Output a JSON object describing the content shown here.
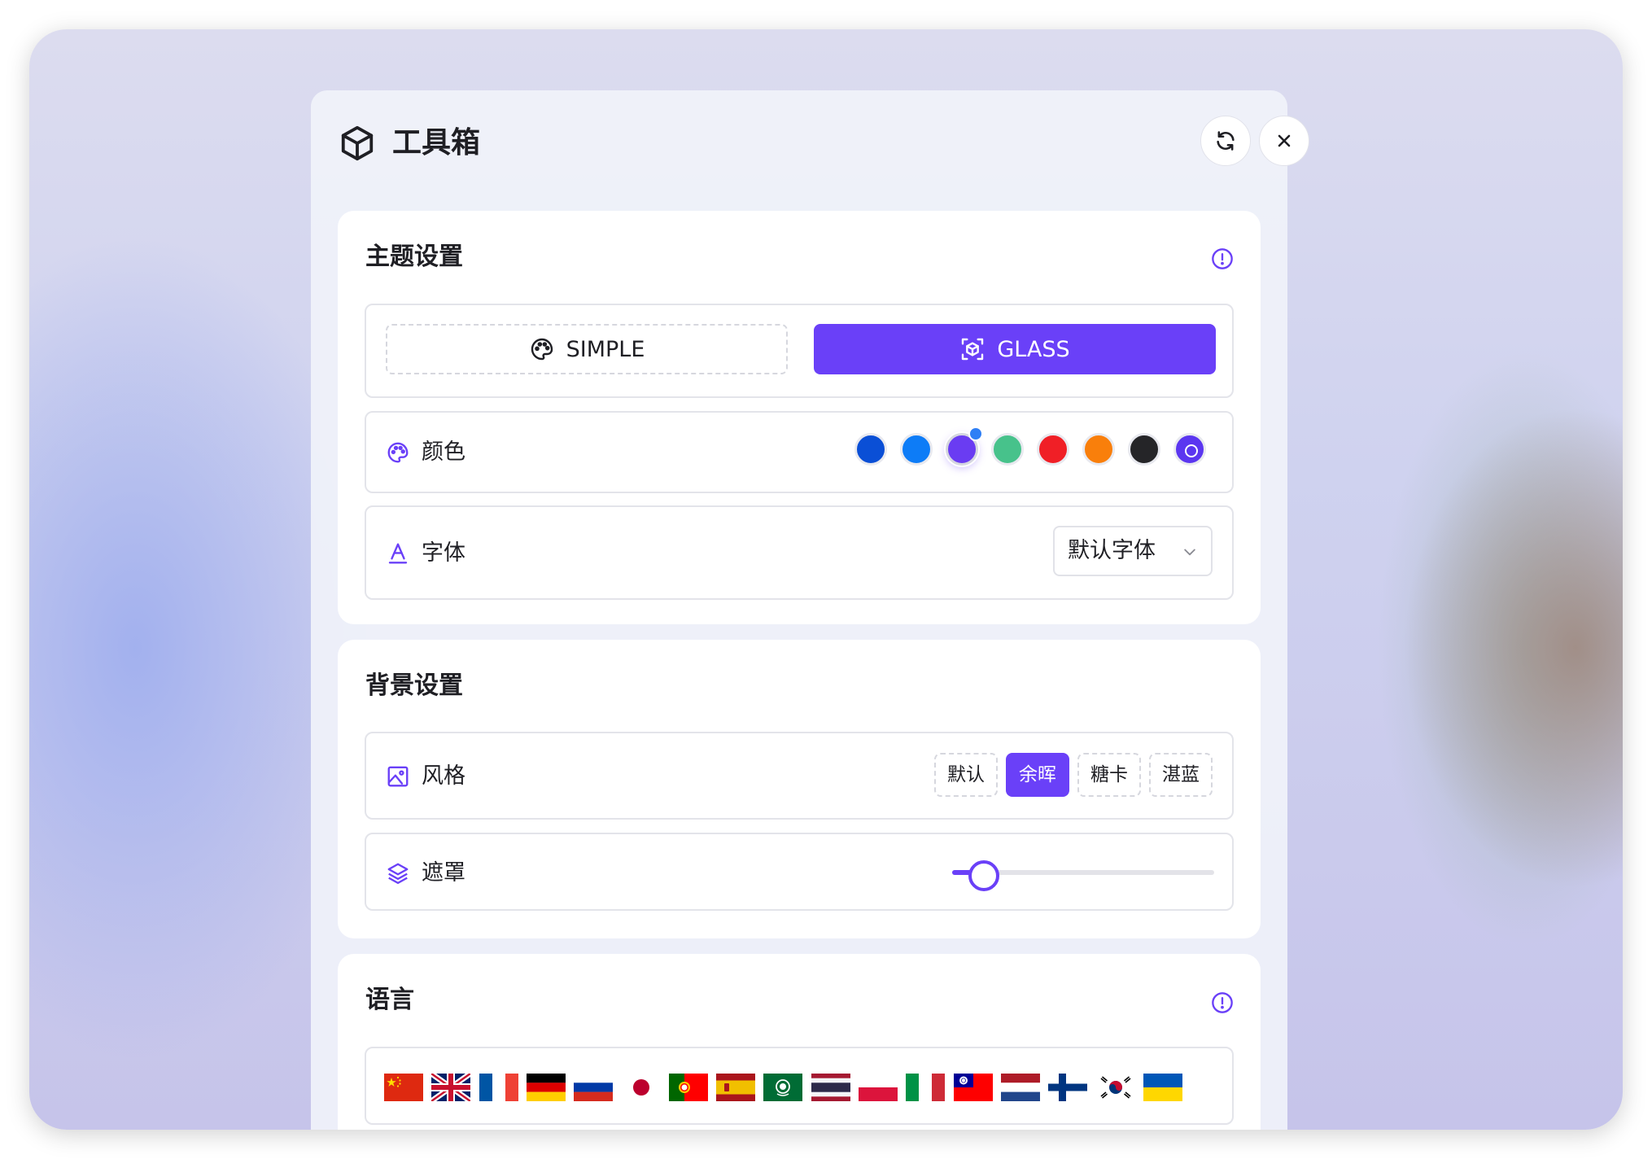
{
  "header": {
    "title": "工具箱",
    "logo_icon": "cube-icon",
    "refresh_icon": "refresh-icon",
    "close_icon": "close-icon"
  },
  "theme": {
    "title": "主题设置",
    "modes": [
      {
        "label": "SIMPLE",
        "icon": "palette-icon",
        "selected": false
      },
      {
        "label": "GLASS",
        "icon": "scan-cube-icon",
        "selected": true
      }
    ],
    "color": {
      "label": "颜色",
      "swatches": [
        "#0a4fd6",
        "#0d7cf7",
        "#6a3cf2",
        "#47c28b",
        "#f01f26",
        "#f97f0b",
        "#252528",
        "#5b36f0"
      ],
      "selected_index": 2
    },
    "font": {
      "label": "字体",
      "value": "默认字体"
    }
  },
  "background": {
    "title": "背景设置",
    "style": {
      "label": "风格",
      "options": [
        "默认",
        "余晖",
        "糖卡",
        "湛蓝"
      ],
      "selected_index": 1
    },
    "mask": {
      "label": "遮罩",
      "value": 0.12
    }
  },
  "language": {
    "title": "语言",
    "flags": [
      "china-flag",
      "uk-flag",
      "france-flag",
      "germany-flag",
      "russia-flag",
      "japan-flag",
      "portugal-flag",
      "spain-flag",
      "arab-league-flag",
      "thailand-flag",
      "poland-flag",
      "italy-flag",
      "taiwan-flag",
      "netherlands-flag",
      "finland-flag",
      "south-korea-flag",
      "ukraine-flag"
    ]
  },
  "accent_color": "#6a40f8"
}
